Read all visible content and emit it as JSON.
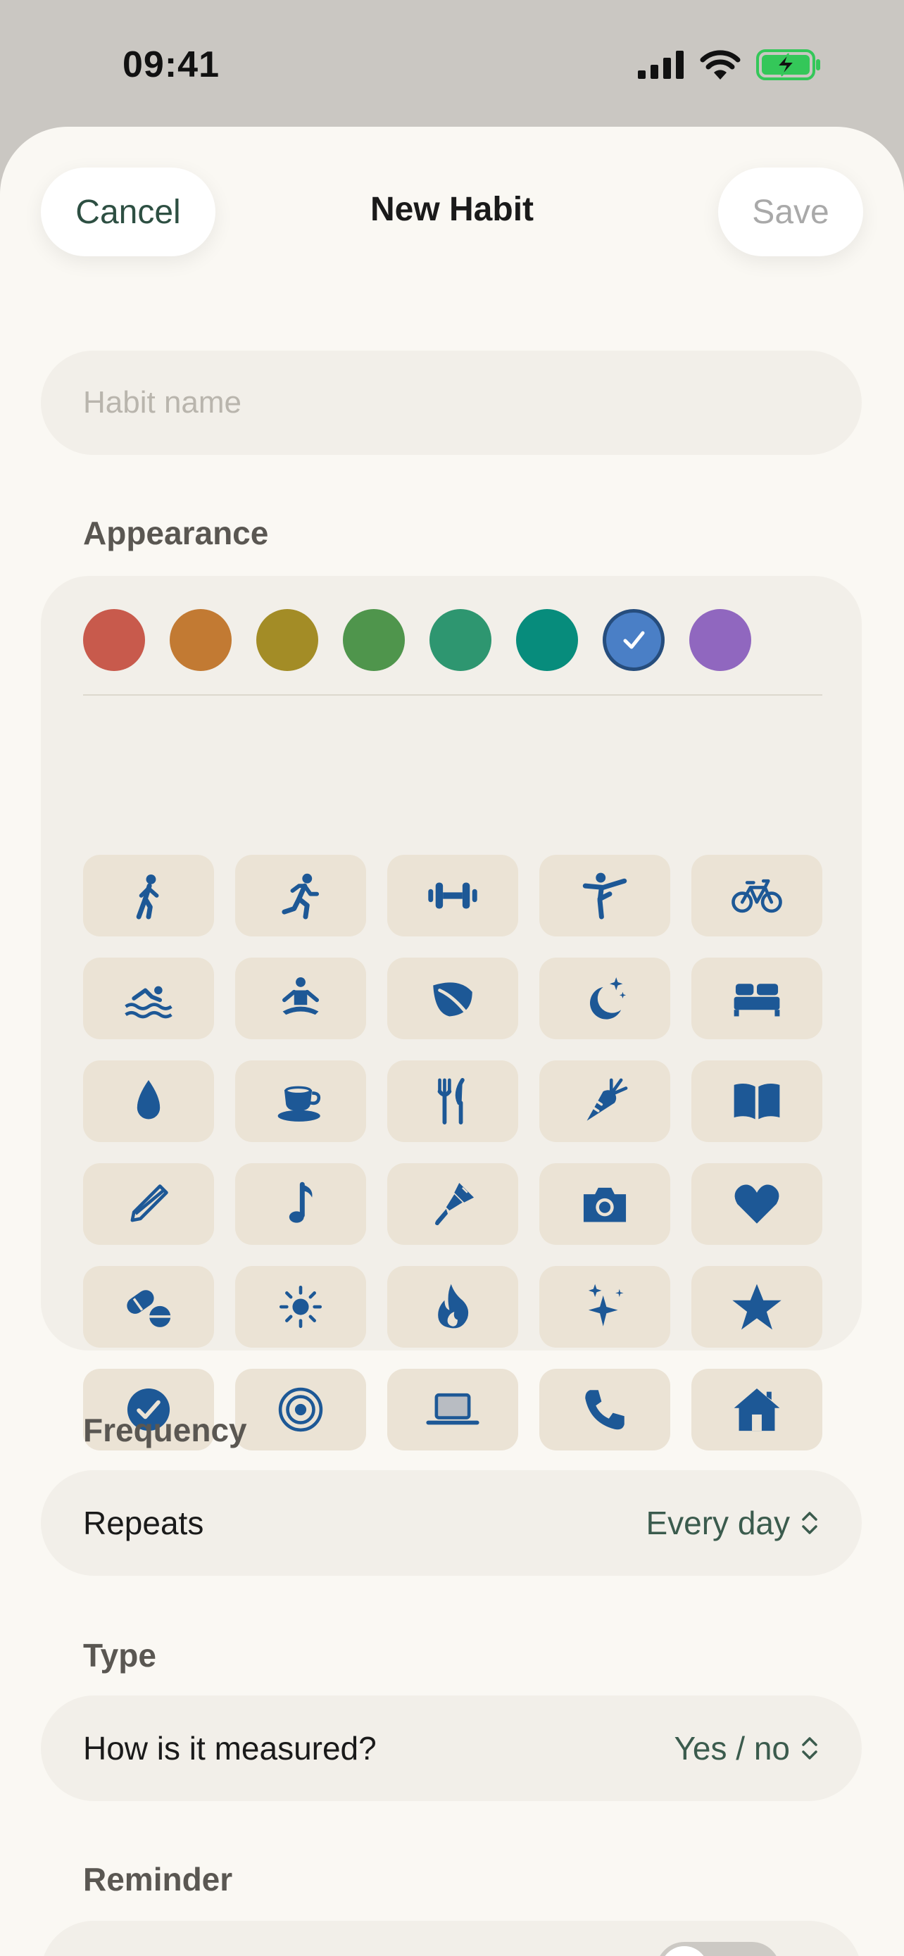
{
  "status_bar": {
    "time": "09:41"
  },
  "header": {
    "cancel_label": "Cancel",
    "title": "New Habit",
    "save_label": "Save"
  },
  "habit_name": {
    "placeholder": "Habit name",
    "value": ""
  },
  "appearance": {
    "label": "Appearance",
    "colors": [
      {
        "name": "red",
        "hex": "#c85a4c",
        "selected": false
      },
      {
        "name": "orange",
        "hex": "#c27a33",
        "selected": false
      },
      {
        "name": "mustard",
        "hex": "#a38c26",
        "selected": false
      },
      {
        "name": "green",
        "hex": "#4f954c",
        "selected": false
      },
      {
        "name": "emerald",
        "hex": "#2e9670",
        "selected": false
      },
      {
        "name": "teal",
        "hex": "#078c7c",
        "selected": false
      },
      {
        "name": "blue",
        "hex": "#4a7fc6",
        "selected": true
      },
      {
        "name": "purple",
        "hex": "#9067bf",
        "selected": false
      }
    ],
    "icon_color": "#1d5896",
    "icons": [
      "walking-icon",
      "running-icon",
      "dumbbell-icon",
      "stretching-icon",
      "bicycle-icon",
      "swimming-icon",
      "meditation-icon",
      "leaf-icon",
      "moon-stars-icon",
      "bed-icon",
      "water-drop-icon",
      "cup-icon",
      "fork-knife-icon",
      "carrot-icon",
      "book-icon",
      "pencil-icon",
      "music-note-icon",
      "paintbrush-icon",
      "camera-icon",
      "heart-icon",
      "pills-icon",
      "sun-icon",
      "flame-icon",
      "sparkles-icon",
      "star-icon",
      "checkmark-circle-icon",
      "target-icon",
      "laptop-icon",
      "phone-icon",
      "house-icon"
    ]
  },
  "frequency": {
    "label": "Frequency",
    "row_label": "Repeats",
    "value": "Every day"
  },
  "type": {
    "label": "Type",
    "row_label": "How is it measured?",
    "value": "Yes / no"
  },
  "reminder": {
    "label": "Reminder",
    "enabled": false
  }
}
